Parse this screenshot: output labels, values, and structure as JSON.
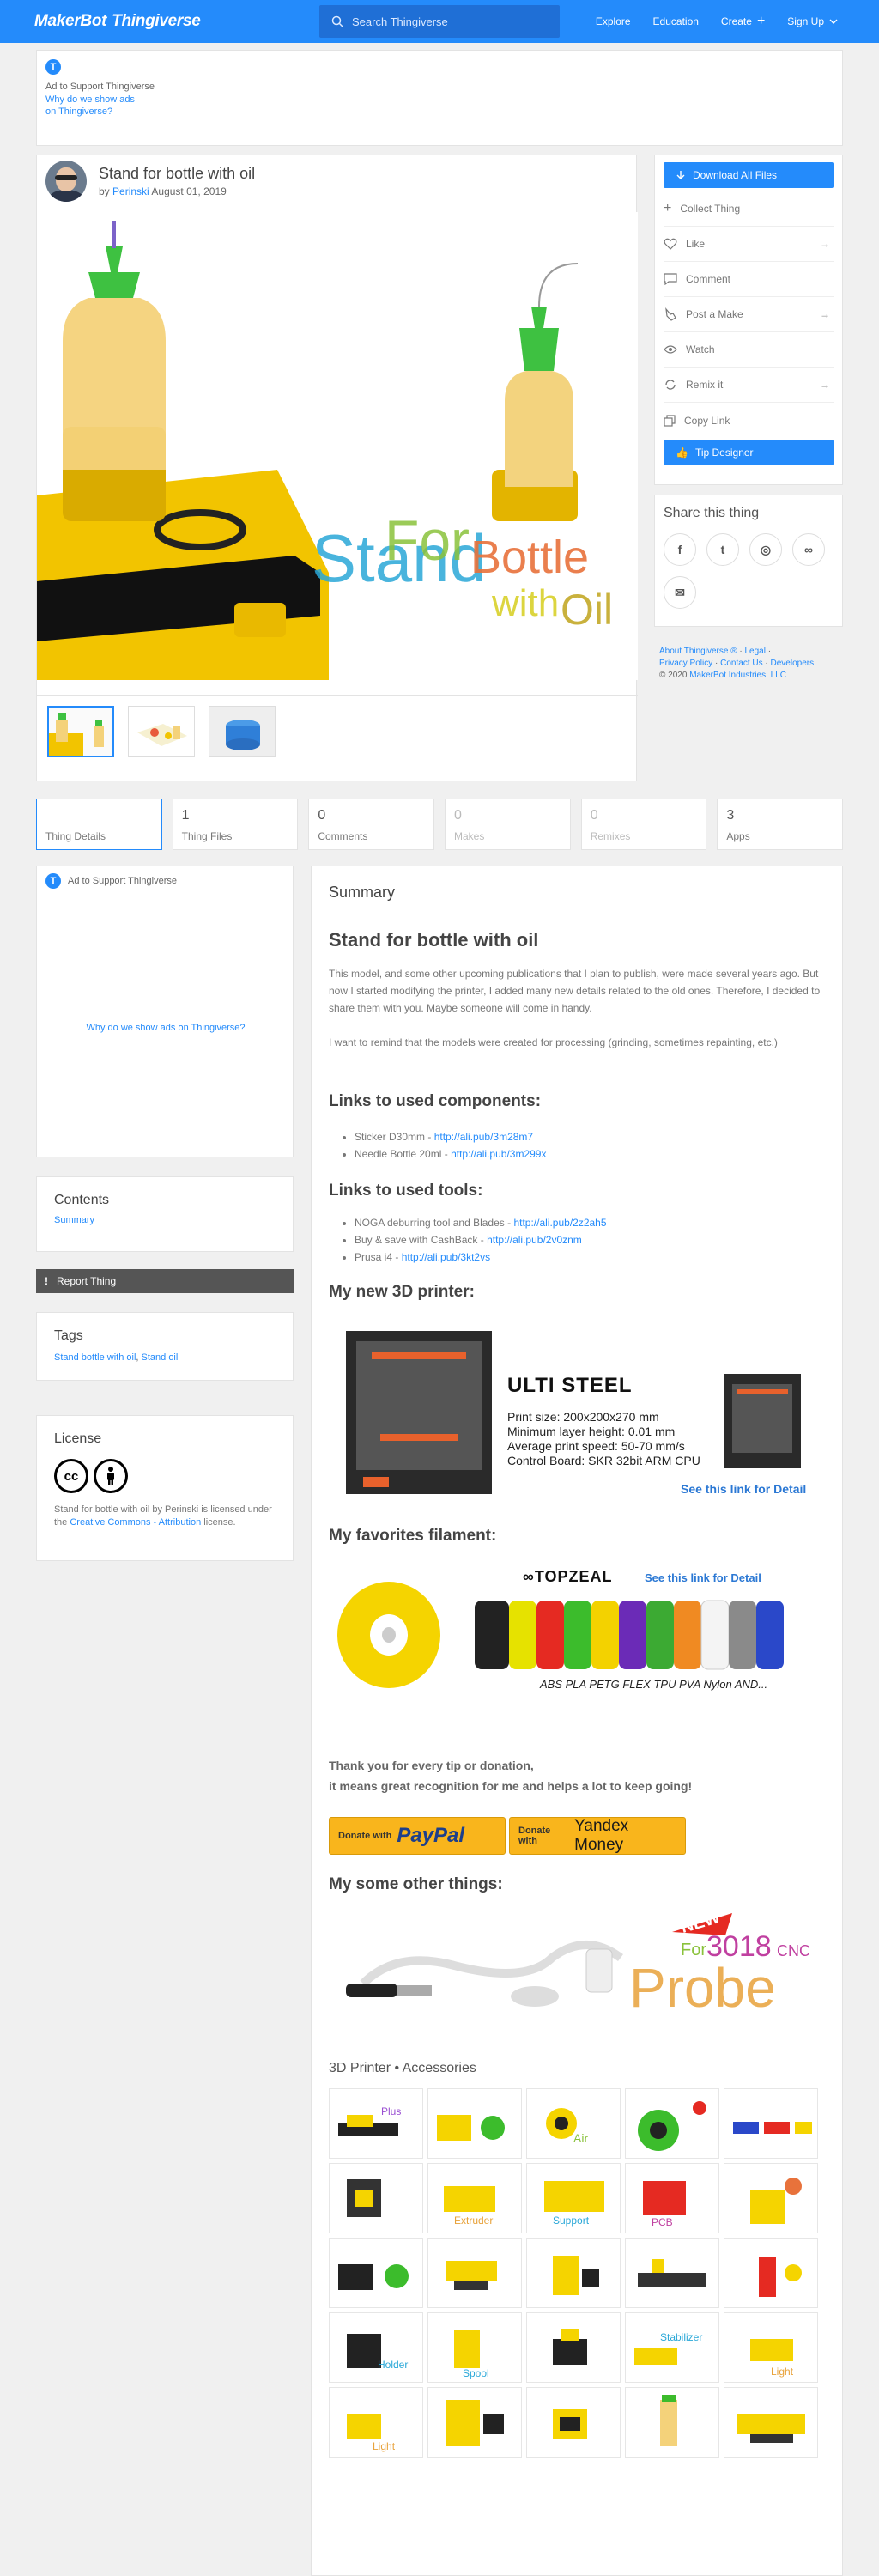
{
  "header": {
    "logo_makerbot": "MakerBot",
    "logo_thingiverse": "Thingiverse",
    "search_placeholder": "Search Thingiverse",
    "nav": {
      "explore": "Explore",
      "education": "Education",
      "create": "Create",
      "signup": "Sign Up"
    }
  },
  "top_ad": {
    "line1": "Ad to Support Thingiverse",
    "link1": "Why do we show ads",
    "link2": "on Thingiverse?"
  },
  "thing": {
    "title": "Stand for bottle with oil",
    "by_prefix": "by",
    "author": "Perinski",
    "date": "August 01, 2019",
    "hero_text": {
      "stand": "Stand",
      "for": "For",
      "bottle": "Bottle",
      "with": "with",
      "oil": "Oil"
    }
  },
  "actions": {
    "download": "Download All Files",
    "collect": "Collect Thing",
    "like": "Like",
    "comment": "Comment",
    "post_make": "Post a Make",
    "watch": "Watch",
    "remix": "Remix it",
    "copy_link": "Copy Link",
    "tip": "Tip Designer"
  },
  "share": {
    "title": "Share this thing"
  },
  "footer": {
    "about": "About Thingiverse ®",
    "legal": "Legal",
    "privacy": "Privacy Policy",
    "contact": "Contact Us",
    "developers": "Developers",
    "copyright": "© 2020",
    "company": "MakerBot Industries, LLC"
  },
  "tabs": [
    {
      "num": "",
      "label": "Thing Details"
    },
    {
      "num": "1",
      "label": "Thing Files"
    },
    {
      "num": "0",
      "label": "Comments"
    },
    {
      "num": "0",
      "label": "Makes"
    },
    {
      "num": "0",
      "label": "Remixes"
    },
    {
      "num": "3",
      "label": "Apps"
    }
  ],
  "left_ad": {
    "line": "Ad to Support Thingiverse",
    "link": "Why do we show ads on Thingiverse?"
  },
  "contents": {
    "title": "Contents",
    "item": "Summary"
  },
  "report": {
    "label": "Report Thing"
  },
  "tags": {
    "title": "Tags",
    "t1": "Stand bottle with oil",
    "t2": "Stand oil"
  },
  "license": {
    "title": "License",
    "text1": "Stand for bottle with oil by Perinski is licensed under the",
    "link": "Creative Commons - Attribution",
    "text2": "license."
  },
  "summary": {
    "section_title": "Summary",
    "heading": "Stand for bottle with oil",
    "para1": "This model, and some other upcoming publications that I plan to publish, were made several years ago. But now I started modifying the printer, I added many new details related to the old ones. Therefore, I decided to share them with you. Maybe someone will come in handy.",
    "para2": "I want to remind that the models were created for processing (grinding, sometimes repainting, etc.)",
    "components_heading": "Links to used components:",
    "components": [
      {
        "text": "Sticker D30mm - ",
        "link": "http://ali.pub/3m28m7"
      },
      {
        "text": "Needle Bottle 20ml - ",
        "link": "http://ali.pub/3m299x"
      }
    ],
    "tools_heading": "Links to used tools:",
    "tools": [
      {
        "text": "NOGA deburring tool and Blades - ",
        "link": "http://ali.pub/2z2ah5"
      },
      {
        "text": "Buy & save with CashBack - ",
        "link": "http://ali.pub/2v0znm"
      },
      {
        "text": "Prusa i4 - ",
        "link": "http://ali.pub/3kt2vs"
      }
    ],
    "printer_heading": "My new 3D printer:",
    "printer_banner": {
      "name": "ULTI STEEL",
      "spec1": "Print size: 200x200x270 mm",
      "spec2": "Minimum layer height: 0.01 mm",
      "spec3": "Average print speed: 50-70 mm/s",
      "spec4": "Control Board: SKR 32bit ARM CPU",
      "link": "See this link for Detail"
    },
    "filament_heading": "My favorites filament:",
    "filament_banner": {
      "brand": "TOPZEAL",
      "link": "See this link for Detail",
      "types": "ABS PLA PETG FLEX TPU PVA Nylon AND..."
    },
    "thanks1": "Thank you for every tip or donation,",
    "thanks2": "it means great recognition for me and helps a lot to keep going!",
    "donate_paypal_prefix": "Donate with",
    "donate_paypal": "PayPal",
    "donate_yandex_prefix": "Donate with",
    "donate_yandex": "Yandex Money",
    "other_heading": "My some other things:",
    "probe_banner": {
      "new": "NEW",
      "for": "For",
      "model": "3018",
      "cnc": "CNC",
      "probe": "Probe"
    },
    "collection_title": "3D Printer • Accessories"
  },
  "colors": {
    "brand_blue": "#248bfb",
    "yellow": "#f5d400",
    "green": "#38c23c"
  }
}
